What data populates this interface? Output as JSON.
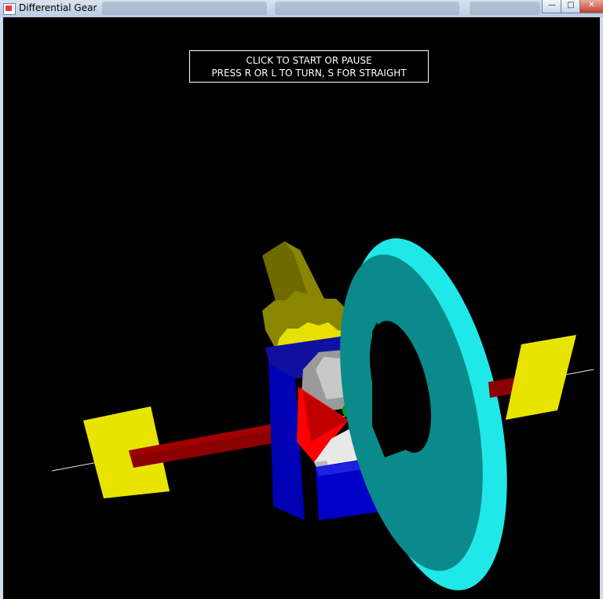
{
  "window": {
    "title": "Differential Gear",
    "minimize_glyph": "—",
    "maximize_glyph": "□",
    "close_glyph": "✕"
  },
  "info": {
    "line1": "CLICK TO START OR PAUSE",
    "line2": "PRESS  R  OR  L  TO TURN, S FOR STRAIGHT"
  },
  "colors": {
    "axle": "#8b0000",
    "mounts": "#f0e000",
    "ring_gear": "#20e8e8",
    "ring_gear_dark": "#0a8a8a",
    "pinion": "#e8e000",
    "housing": "#0010c8",
    "side_gears": "#e8e8e8",
    "spider_gears": "#ff0000",
    "pins": "#00a000"
  }
}
